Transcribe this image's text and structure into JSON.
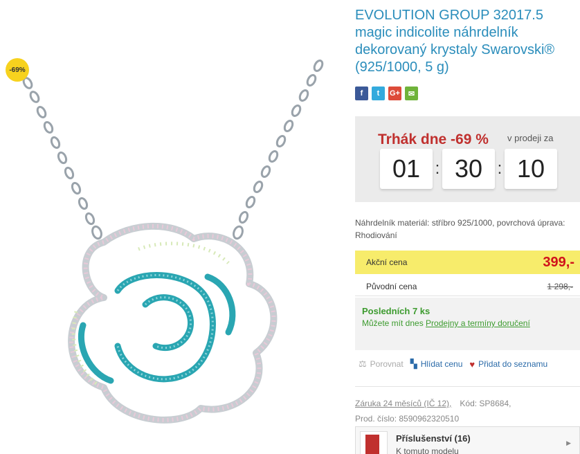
{
  "product": {
    "title": "EVOLUTION GROUP 32017.5 magic indicolite náhrdelník dekorovaný krystaly Swarovski® (925/1000, 5 g)",
    "discount_badge": "-69%",
    "image_icon": "necklace-pendant-image"
  },
  "social": {
    "facebook": "f",
    "twitter": "t",
    "googleplus": "G+",
    "email": "✉"
  },
  "deal": {
    "title": "Trhák dne -69 %",
    "subtitle": "v prodeji za",
    "hours": "01",
    "minutes": "30",
    "seconds": "10",
    "sep": ":"
  },
  "material": "Náhrdelník materiál: stříbro 925/1000, povrchová úprava: Rhodiování",
  "prices": {
    "action_label": "Akční cena",
    "action_value": "399,-",
    "original_label": "Původní cena",
    "original_value": "1 298,-"
  },
  "stock": {
    "title": "Posledních 7 ks",
    "sub_prefix": "Můžete mít dnes ",
    "sub_link": "Prodejny a termíny doručení"
  },
  "actions": {
    "compare": "Porovnat",
    "watch": "Hlídat cenu",
    "wishlist": "Přidat do seznamu"
  },
  "meta": {
    "warranty": "Záruka 24 měsíců (IČ 12),",
    "code_label": "Kód:",
    "code_value": "SP8684,",
    "prod_label": "Prod. číslo:",
    "prod_value": "8590962320510"
  },
  "accessories": {
    "title": "Příslušenství (16)",
    "subtitle": "K tomuto modelu"
  },
  "colors": {
    "title_blue": "#2a8dbb",
    "deal_red": "#c0302e",
    "price_red": "#d0121b",
    "action_yellow": "#f7ec6b",
    "badge_yellow": "#f7d21e",
    "stock_green": "#3d9b2f"
  }
}
